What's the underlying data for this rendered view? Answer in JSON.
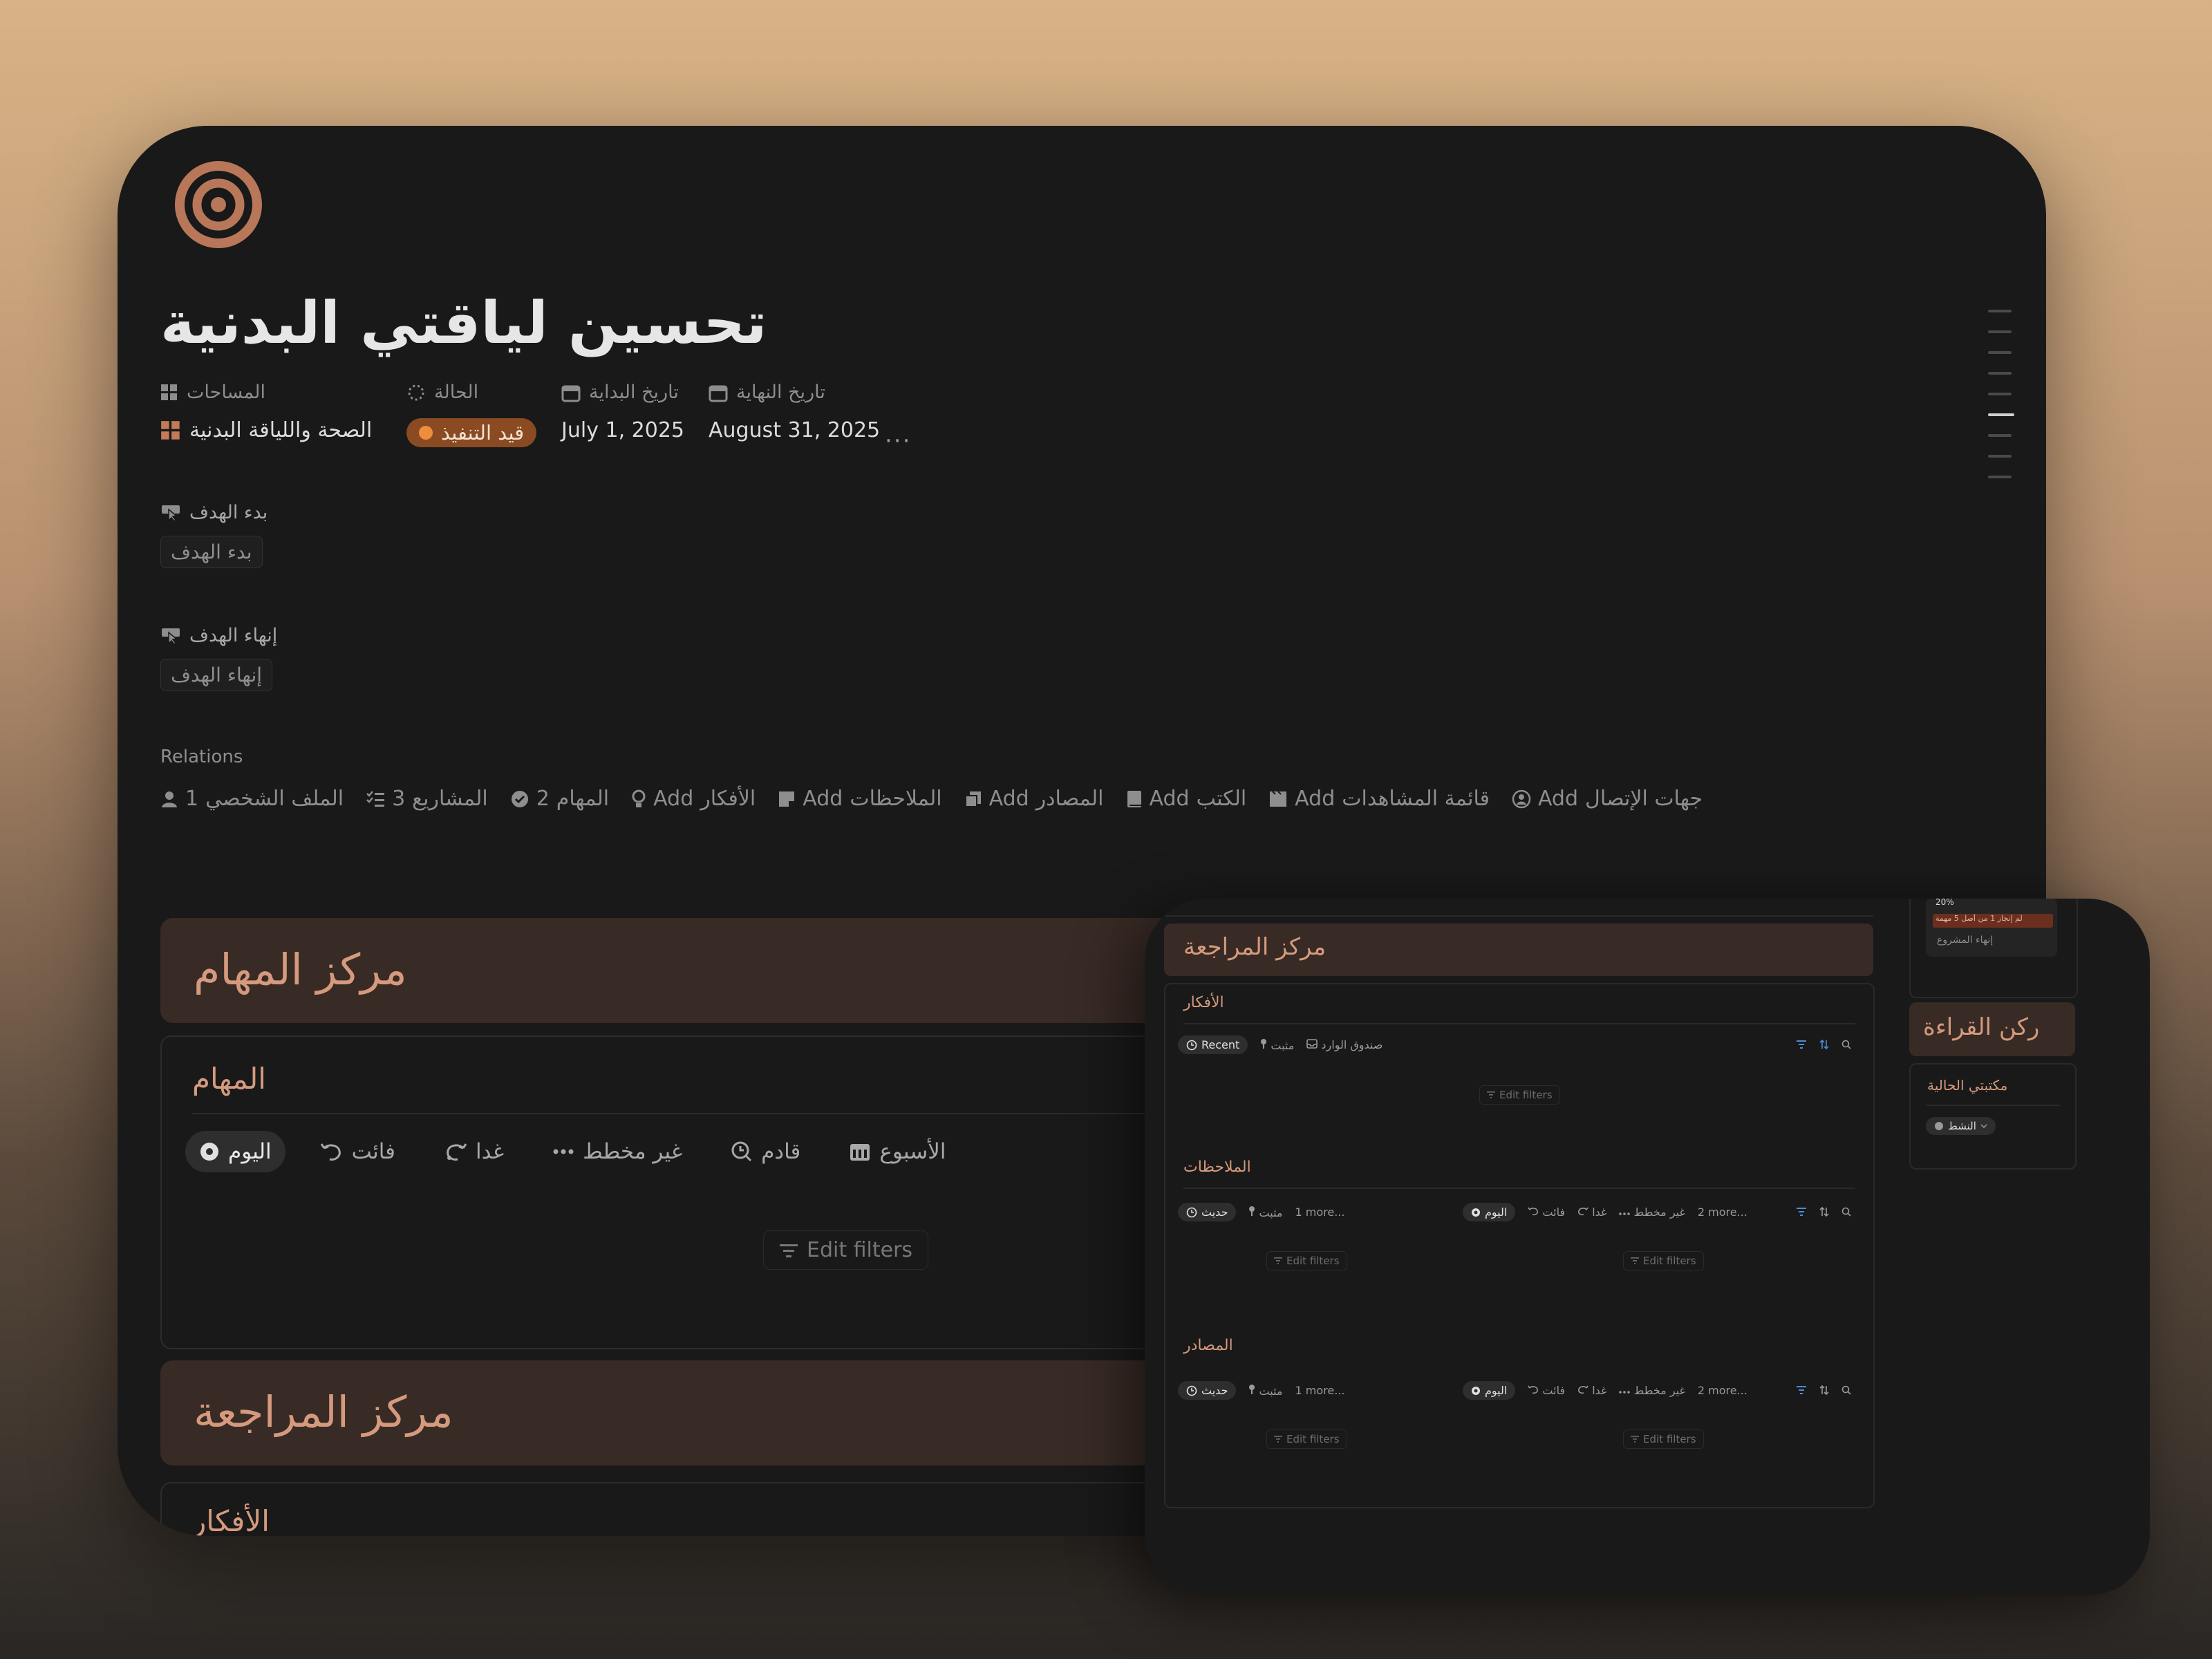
{
  "page": {
    "title": "تحسين لياقتي البدنية",
    "more": "···"
  },
  "properties": {
    "spaces": {
      "label": "المساحات",
      "value": "الصحة واللياقة البدنية"
    },
    "status": {
      "label": "الحالة",
      "value": "قيد التنفيذ"
    },
    "start_date": {
      "label": "تاريخ البداية",
      "value": "July 1, 2025"
    },
    "end_date": {
      "label": "تاريخ النهاية",
      "value": "August 31, 2025"
    }
  },
  "buttons": {
    "start_goal": {
      "label": "بدء الهدف",
      "button": "بدء الهدف"
    },
    "end_goal": {
      "label": "إنهاء الهدف",
      "button": "إنهاء الهدف"
    }
  },
  "relations": {
    "title": "Relations",
    "items": [
      {
        "name": "الملف الشخصي",
        "value": "1",
        "icon": "person-icon"
      },
      {
        "name": "المشاريع",
        "value": "3",
        "icon": "checklist-icon"
      },
      {
        "name": "المهام",
        "value": "2",
        "icon": "check-circle-icon"
      },
      {
        "name": "الأفكار",
        "value": "Add",
        "icon": "lightbulb-icon"
      },
      {
        "name": "الملاحظات",
        "value": "Add",
        "icon": "note-icon"
      },
      {
        "name": "المصادر",
        "value": "Add",
        "icon": "copy-icon"
      },
      {
        "name": "الكتب",
        "value": "Add",
        "icon": "book-icon"
      },
      {
        "name": "قائمة المشاهدات",
        "value": "Add",
        "icon": "film-icon"
      },
      {
        "name": "جهات الإتصال",
        "value": "Add",
        "icon": "contact-icon"
      }
    ]
  },
  "task_center": {
    "header": "مركز المهام",
    "title": "المهام",
    "tabs": [
      "اليوم",
      "فائت",
      "غدا",
      "غير مخطط",
      "قادم",
      "الأسبوع"
    ],
    "edit_filters": "Edit filters"
  },
  "review_center": {
    "header": "مركز المراجعة",
    "ideas_title": "الأفكار"
  },
  "overlay": {
    "header": "مركز المراجعة",
    "ideas": {
      "title": "الأفكار",
      "tabs": [
        "Recent",
        "مثبت",
        "صندوق الوارد"
      ],
      "edit_filters": "Edit filters"
    },
    "notes": {
      "title": "الملاحظات",
      "left_tabs": [
        "حديث",
        "مثبت",
        "1 more..."
      ],
      "right_tabs": [
        "اليوم",
        "فائت",
        "غدا",
        "غير مخطط",
        "2 more..."
      ],
      "edit_filters": "Edit filters"
    },
    "sources": {
      "title": "المصادر",
      "left_tabs": [
        "حديث",
        "مثبت",
        "1 more..."
      ],
      "right_tabs": [
        "اليوم",
        "فائت",
        "غدا",
        "غير مخطط",
        "2 more..."
      ],
      "edit_filters": "Edit filters"
    },
    "side": {
      "progress_pct": "20%",
      "progress_text": "لم إنجاز 1 من أصل 5 مهمة",
      "end_project": "إنهاء المشروع",
      "reading_header": "ركن القراءة",
      "library_title": "مكتبتي الحالية",
      "library_filter": "النشط"
    }
  },
  "colors": {
    "accent": "#d59a7d",
    "status_bg": "#8a4a22",
    "status_dot": "#ef8c3d",
    "tool_blue": "#4c8bd6"
  }
}
